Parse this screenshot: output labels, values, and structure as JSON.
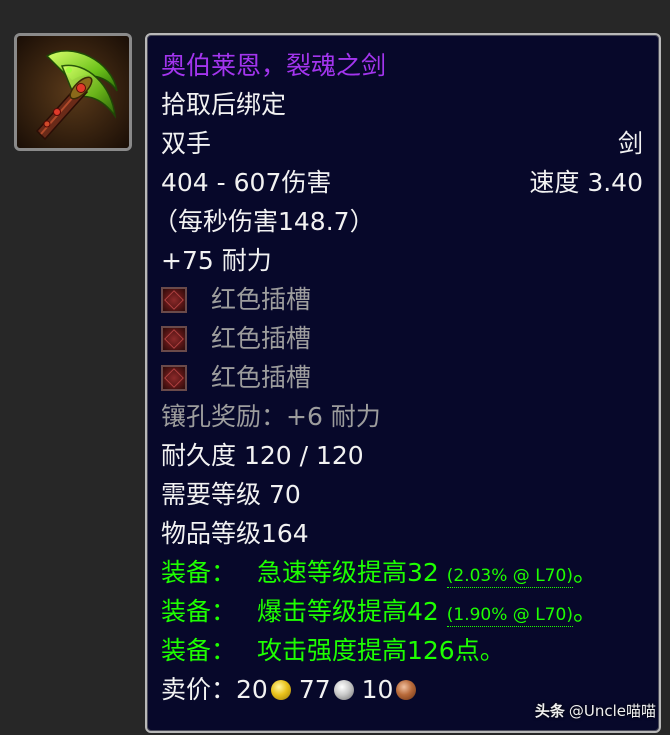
{
  "icon": {
    "name": "sword-item-icon",
    "colors": {
      "blade": "#7ed321",
      "hilt": "#c0392b",
      "gem": "#e74c3c"
    }
  },
  "tooltip": {
    "item_name": "奥伯莱恩，裂魂之剑",
    "item_name_color": "#a335ee",
    "binding": "拾取后绑定",
    "slot": "双手",
    "weapon_type": "剑",
    "damage": "404 - 607伤害",
    "speed": "速度 3.40",
    "dps": "（每秒伤害148.7）",
    "stamina": "+75 耐力",
    "sockets": [
      {
        "label": "红色插槽",
        "icon": "red-socket-icon"
      },
      {
        "label": "红色插槽",
        "icon": "red-socket-icon"
      },
      {
        "label": "红色插槽",
        "icon": "red-socket-icon"
      }
    ],
    "socket_bonus": "镶孔奖励：+6 耐力",
    "durability": "耐久度 120 / 120",
    "required_level": "需要等级 70",
    "item_level": "物品等级164",
    "equip_effects": [
      {
        "prefix": "装备：",
        "text": "急速等级提高32",
        "detail": "(2.03% @ L70)",
        "suffix": "。"
      },
      {
        "prefix": "装备：",
        "text": "爆击等级提高42",
        "detail": "(1.90% @ L70)",
        "suffix": "。"
      },
      {
        "prefix": "装备：",
        "text": "攻击强度提高126点。",
        "detail": "",
        "suffix": ""
      }
    ],
    "sell_price": {
      "label": "卖价：",
      "gold": "20",
      "silver": "77",
      "copper": "10"
    }
  },
  "watermark": {
    "brand": "头条",
    "handle": "@Uncle喵喵"
  }
}
